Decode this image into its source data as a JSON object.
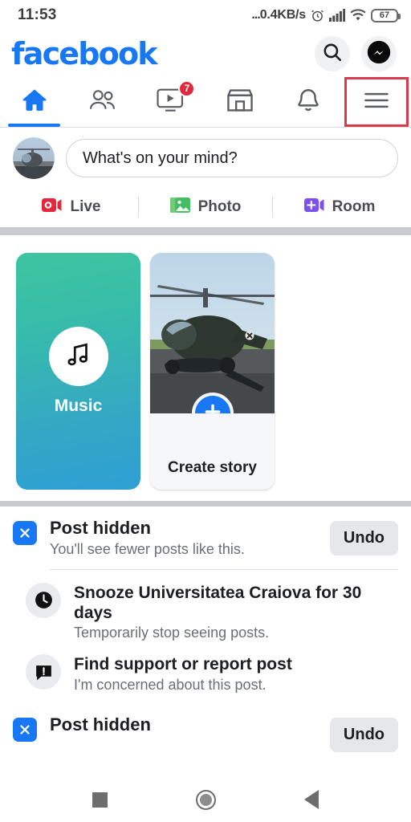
{
  "status_bar": {
    "time": "11:53",
    "dots": "...",
    "network_speed": "0.4KB/s",
    "alarm_icon": "alarm-clock-icon",
    "signal_icon": "signal-bars-icon",
    "wifi_icon": "wifi-icon",
    "battery_level": "67"
  },
  "header": {
    "brand": "facebook",
    "brand_color": "#1877f2",
    "search_icon": "search-icon",
    "messenger_icon": "messenger-icon"
  },
  "tabs": [
    {
      "name": "home",
      "icon": "home-icon",
      "active": true,
      "badge": ""
    },
    {
      "name": "friends",
      "icon": "friends-icon",
      "active": false,
      "badge": ""
    },
    {
      "name": "watch",
      "icon": "video-play-icon",
      "active": false,
      "badge": "7"
    },
    {
      "name": "marketplace",
      "icon": "marketplace-icon",
      "active": false,
      "badge": ""
    },
    {
      "name": "notifications",
      "icon": "bell-icon",
      "active": false,
      "badge": ""
    },
    {
      "name": "menu",
      "icon": "hamburger-menu-icon",
      "active": false,
      "badge": "",
      "highlighted": true
    }
  ],
  "highlight_color": "#d93a4a",
  "composer": {
    "avatar": "user-avatar-helicopter",
    "placeholder": "What's on your mind?",
    "actions": [
      {
        "label": "Live",
        "icon": "live-video-icon",
        "color": "#e4283c"
      },
      {
        "label": "Photo",
        "icon": "photo-icon",
        "color": "#45bd62"
      },
      {
        "label": "Room",
        "icon": "room-video-icon",
        "color": "#7b4ff0"
      }
    ]
  },
  "stories": [
    {
      "type": "music",
      "label": "Music",
      "icon": "music-note-icon"
    },
    {
      "type": "create",
      "label": "Create story",
      "icon": "plus-icon"
    }
  ],
  "feed": {
    "hidden_post": {
      "icon": "x-close-icon",
      "title": "Post hidden",
      "subtitle": "You'll see fewer posts like this.",
      "undo_label": "Undo"
    },
    "options": [
      {
        "icon": "clock-icon",
        "title": "Snooze Universitatea Craiova for 30 days",
        "subtitle": "Temporarily stop seeing posts."
      },
      {
        "icon": "report-flag-icon",
        "title": "Find support or report post",
        "subtitle": "I'm concerned about this post."
      }
    ],
    "hidden_post_2": {
      "icon": "x-close-icon",
      "title": "Post hidden",
      "undo_label": "Undo"
    }
  },
  "android_nav": {
    "recent_icon": "square-recents-icon",
    "home_icon": "circle-home-icon",
    "back_icon": "triangle-back-icon"
  }
}
